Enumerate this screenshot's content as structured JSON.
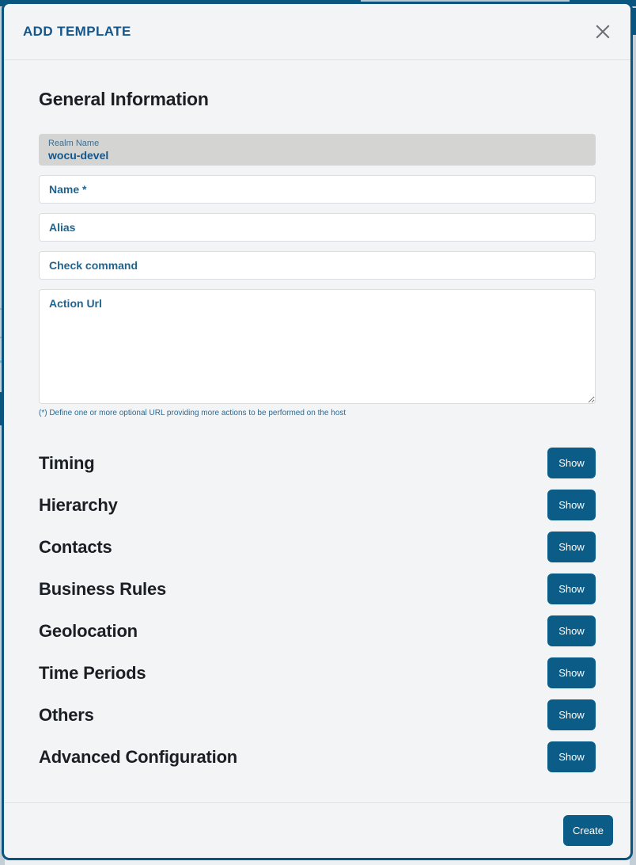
{
  "modal": {
    "title": "ADD TEMPLATE",
    "close_icon": "close-icon"
  },
  "general_information": {
    "heading": "General Information",
    "realm": {
      "label": "Realm Name",
      "value": "wocu-devel"
    },
    "fields": [
      {
        "name": "name",
        "placeholder": "Name *",
        "value": ""
      },
      {
        "name": "alias",
        "placeholder": "Alias",
        "value": ""
      },
      {
        "name": "check_command",
        "placeholder": "Check command",
        "value": ""
      }
    ],
    "action_url": {
      "placeholder": "Action Url",
      "value": "",
      "helper": "(*) Define one or more optional URL providing more actions to be performed on the host"
    }
  },
  "sections": [
    {
      "label": "Timing",
      "button": "Show"
    },
    {
      "label": "Hierarchy",
      "button": "Show"
    },
    {
      "label": "Contacts",
      "button": "Show"
    },
    {
      "label": "Business Rules",
      "button": "Show"
    },
    {
      "label": "Geolocation",
      "button": "Show"
    },
    {
      "label": "Time Periods",
      "button": "Show"
    },
    {
      "label": "Others",
      "button": "Show"
    },
    {
      "label": "Advanced Configuration",
      "button": "Show"
    }
  ],
  "footer": {
    "create_label": "Create"
  },
  "colors": {
    "brand_blue": "#0a5580",
    "button_blue": "#0b5c87",
    "modal_bg": "#f2f4f6",
    "readonly_bg": "#d4d4d2",
    "heading_text": "#1b1f24",
    "label_blue": "#14568a"
  }
}
